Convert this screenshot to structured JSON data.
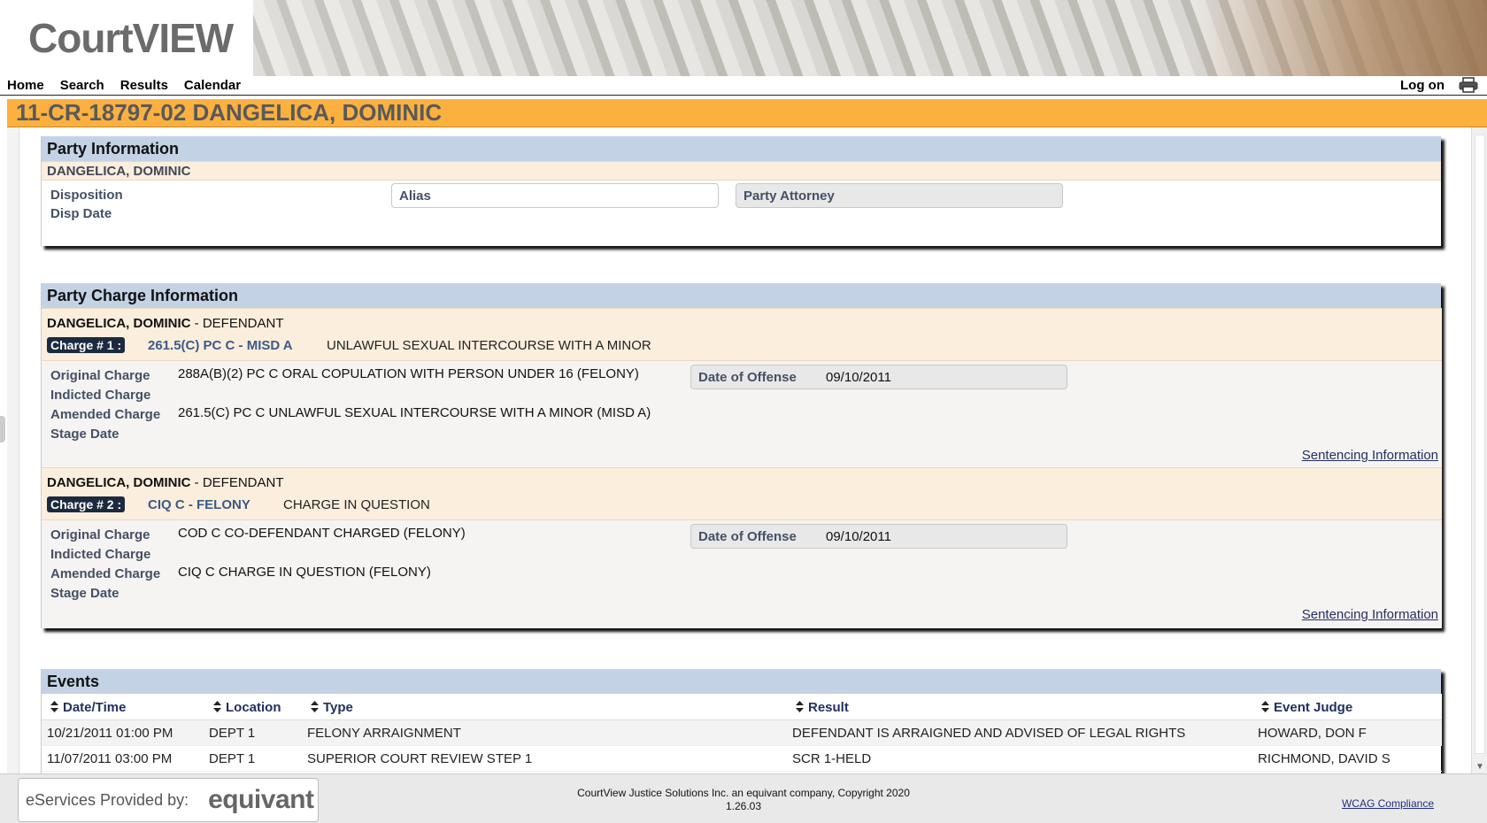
{
  "app": {
    "logo": "CourtVIEW"
  },
  "nav": {
    "home": "Home",
    "search": "Search",
    "results": "Results",
    "calendar": "Calendar",
    "logon": "Log on"
  },
  "case_title": "11-CR-18797-02 DANGELICA, DOMINIC",
  "party_info": {
    "heading": "Party Information",
    "name": "DANGELICA, DOMINIC",
    "disposition_label": "Disposition",
    "disp_date_label": "Disp Date",
    "alias_label": "Alias",
    "attorney_label": "Party Attorney"
  },
  "charges": {
    "heading": "Party Charge Information",
    "items": [
      {
        "party_name": "DANGELICA, DOMINIC",
        "role": " - DEFENDANT",
        "badge": "Charge # 1 :",
        "code": "261.5(C) PC C - MISD A",
        "description": "UNLAWFUL SEXUAL INTERCOURSE WITH A MINOR",
        "original_label": "Original Charge",
        "original_value": "288A(B)(2) PC C ORAL COPULATION WITH PERSON UNDER 16 (FELONY)",
        "indicted_label": "Indicted Charge",
        "amended_label": "Amended Charge",
        "amended_value": "261.5(C) PC C UNLAWFUL SEXUAL INTERCOURSE WITH A MINOR (MISD A)",
        "stage_label": "Stage Date",
        "offense_label": "Date of Offense",
        "offense_date": "09/10/2011",
        "sentencing_link": "Sentencing Information"
      },
      {
        "party_name": "DANGELICA, DOMINIC",
        "role": " - DEFENDANT",
        "badge": "Charge # 2 :",
        "code": "CIQ C - FELONY",
        "description": "CHARGE IN QUESTION",
        "original_label": "Original Charge",
        "original_value": "COD C CO-DEFENDANT CHARGED (FELONY)",
        "indicted_label": "Indicted Charge",
        "amended_label": "Amended Charge",
        "amended_value": "CIQ C CHARGE IN QUESTION (FELONY)",
        "stage_label": "Stage Date",
        "offense_label": "Date of Offense",
        "offense_date": "09/10/2011",
        "sentencing_link": "Sentencing Information"
      }
    ]
  },
  "events": {
    "heading": "Events",
    "columns": [
      "Date/Time",
      "Location",
      "Type",
      "Result",
      "Event Judge"
    ],
    "rows": [
      [
        "10/21/2011 01:00 PM",
        "DEPT 1",
        "FELONY ARRAIGNMENT",
        "DEFENDANT IS ARRAIGNED AND ADVISED OF LEGAL RIGHTS",
        "HOWARD, DON F"
      ],
      [
        "11/07/2011 03:00 PM",
        "DEPT 1",
        "SUPERIOR COURT REVIEW STEP 1",
        "SCR 1-HELD",
        "RICHMOND, DAVID S"
      ]
    ]
  },
  "footer": {
    "eservices_label": "eServices Provided by:",
    "brand": "equivant",
    "copyright": "CourtView Justice Solutions Inc. an equivant company, Copyright 2020",
    "version": "1.26.03",
    "wcag": "WCAG Compliance"
  },
  "colors": {
    "title_bar": "#fbb040",
    "panel_header": "#c3d3e5",
    "party_row": "#fbeedd",
    "badge": "#1c2a40"
  }
}
